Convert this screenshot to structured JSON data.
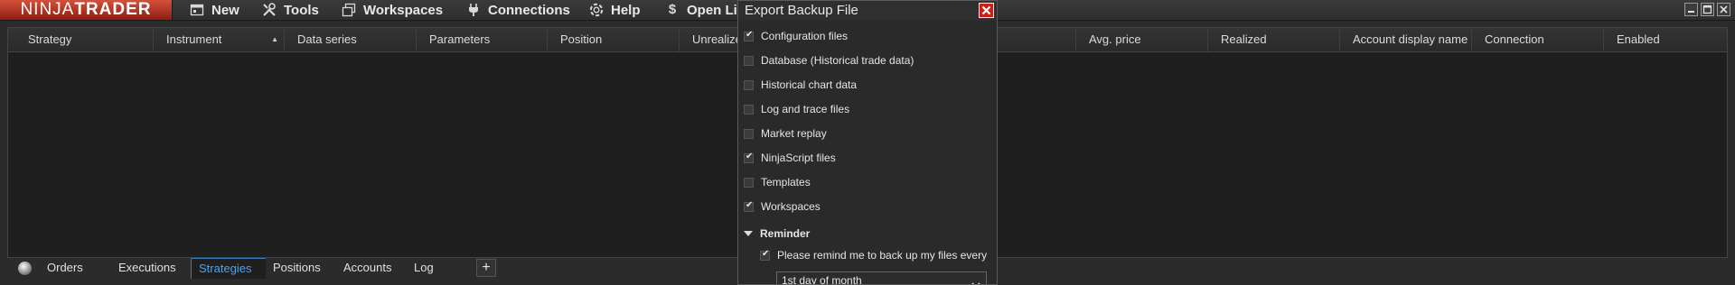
{
  "app": {
    "logo_left": "NINJA",
    "logo_right": "TRADER"
  },
  "menu": [
    {
      "label": "New",
      "icon": "new-window-icon"
    },
    {
      "label": "Tools",
      "icon": "tools-icon"
    },
    {
      "label": "Workspaces",
      "icon": "workspaces-icon"
    },
    {
      "label": "Connections",
      "icon": "plug-icon"
    },
    {
      "label": "Help",
      "icon": "lifebuoy-icon"
    },
    {
      "label": "Open Li",
      "icon": "dollar-icon"
    }
  ],
  "grid": {
    "columns": [
      "Strategy",
      "Instrument",
      "Data series",
      "Parameters",
      "Position",
      "Unrealized",
      "Avg. price",
      "Realized",
      "Account display name",
      "Connection",
      "Enabled"
    ],
    "sorted_column": "Instrument",
    "rows": []
  },
  "tabs": {
    "items": [
      "Orders",
      "Executions",
      "Strategies",
      "Positions",
      "Accounts",
      "Log"
    ],
    "active": "Strategies",
    "add_label": "+"
  },
  "dialog": {
    "title": "Export Backup File",
    "options": [
      {
        "label": "Configuration files",
        "checked": true
      },
      {
        "label": "Database (Historical trade data)",
        "checked": false
      },
      {
        "label": "Historical chart data",
        "checked": false
      },
      {
        "label": "Log and trace files",
        "checked": false
      },
      {
        "label": "Market replay",
        "checked": false
      },
      {
        "label": "NinjaScript files",
        "checked": true
      },
      {
        "label": "Templates",
        "checked": false
      },
      {
        "label": "Workspaces",
        "checked": true
      }
    ],
    "reminder": {
      "section_label": "Reminder",
      "checkbox_label": "Please remind me to back up my files every",
      "checked": true,
      "frequency": "1st day of month"
    }
  },
  "colors": {
    "logo_red": "#b3261a",
    "active_tab": "#3ea6ff",
    "close_button": "#c8211a"
  }
}
